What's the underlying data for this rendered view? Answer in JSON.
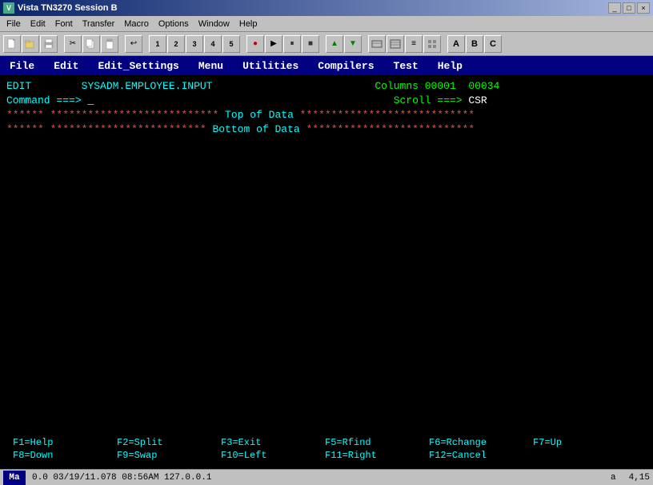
{
  "titlebar": {
    "title": "Vista TN3270 Session B",
    "controls": [
      "_",
      "□",
      "×"
    ]
  },
  "menubar_win": {
    "items": [
      "File",
      "Edit",
      "Font",
      "Transfer",
      "Macro",
      "Options",
      "Window",
      "Help"
    ]
  },
  "app_menubar": {
    "items": [
      "File",
      "Edit",
      "Edit_Settings",
      "Menu",
      "Utilities",
      "Compilers",
      "Test",
      "Help"
    ]
  },
  "terminal": {
    "edit_label": "EDIT",
    "dataset": "SYSADM.EMPLOYEE.INPUT",
    "columns_label": "Columns",
    "columns_value": "00001  00034",
    "command_label": "Command ===>",
    "scroll_label": "Scroll ===>",
    "scroll_value": "CSR",
    "top_of_data": "*************************** Top of Data ****************************",
    "bottom_of_data": "************************* Bottom of Data ***************************",
    "stars_left": "****** ***************************",
    "stars_right": "***************************"
  },
  "funckeys": {
    "row1": [
      {
        "key": "F1=Help",
        "pad": ""
      },
      {
        "key": "F2=Split",
        "pad": ""
      },
      {
        "key": "F3=Exit",
        "pad": ""
      },
      {
        "key": "F5=Rfind",
        "pad": ""
      },
      {
        "key": "F6=Rchange",
        "pad": ""
      },
      {
        "key": "F7=Up",
        "pad": ""
      }
    ],
    "row2": [
      {
        "key": "F8=Down",
        "pad": ""
      },
      {
        "key": "F9=Swap",
        "pad": ""
      },
      {
        "key": "F10=Left",
        "pad": ""
      },
      {
        "key": "F11=Right",
        "pad": ""
      },
      {
        "key": "F12=Cancel",
        "pad": ""
      }
    ]
  },
  "statusbar": {
    "left_indicator": "Ma",
    "info": "0.0  03/19/11.078  08:56AM  127.0.0.1",
    "right_info": "a",
    "cursor_pos": "4,15"
  }
}
